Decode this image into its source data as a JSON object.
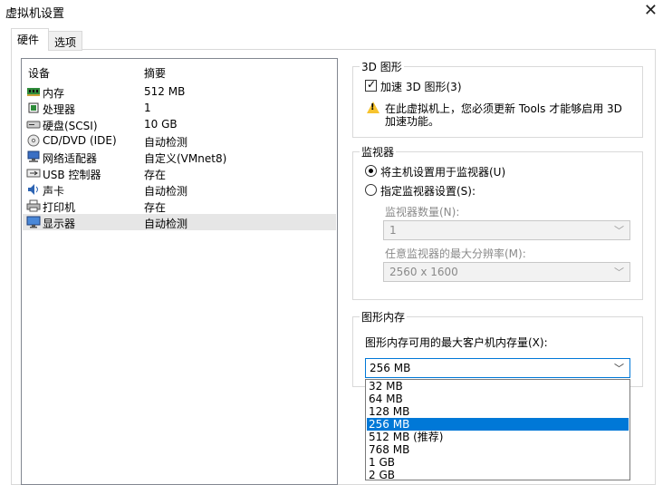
{
  "window": {
    "title": "虚拟机设置"
  },
  "tabs": [
    {
      "label": "硬件",
      "active": true
    },
    {
      "label": "选项",
      "active": false
    }
  ],
  "device_list": {
    "col_device": "设备",
    "col_summary": "摘要",
    "rows": [
      {
        "name": "内存",
        "summary": "512 MB",
        "icon": "memory-icon",
        "selected": false
      },
      {
        "name": "处理器",
        "summary": "1",
        "icon": "processor-icon",
        "selected": false
      },
      {
        "name": "硬盘(SCSI)",
        "summary": "10 GB",
        "icon": "harddisk-icon",
        "selected": false
      },
      {
        "name": "CD/DVD (IDE)",
        "summary": "自动检测",
        "icon": "cd-icon",
        "selected": false
      },
      {
        "name": "网络适配器",
        "summary": "自定义(VMnet8)",
        "icon": "network-icon",
        "selected": false
      },
      {
        "name": "USB 控制器",
        "summary": "存在",
        "icon": "usb-icon",
        "selected": false
      },
      {
        "name": "声卡",
        "summary": "自动检测",
        "icon": "sound-icon",
        "selected": false
      },
      {
        "name": "打印机",
        "summary": "存在",
        "icon": "printer-icon",
        "selected": false
      },
      {
        "name": "显示器",
        "summary": "自动检测",
        "icon": "monitor-icon",
        "selected": true
      }
    ]
  },
  "graphics3d": {
    "legend": "3D 图形",
    "accelerate_label": "加速 3D 图形(3)",
    "accelerate_checked": true,
    "warning_line1": "在此虚拟机上，您必须更新 Tools 才能够启用 3D",
    "warning_line2": "加速功能。"
  },
  "monitor": {
    "legend": "监视器",
    "radio_host": "将主机设置用于监视器(U)",
    "radio_specify": "指定监视器设置(S):",
    "selected": "host",
    "count_label": "监视器数量(N):",
    "count_value": "1",
    "maxres_label": "任意监视器的最大分辨率(M):",
    "maxres_value": "2560 x 1600"
  },
  "graphics_memory": {
    "legend": "图形内存",
    "label": "图形内存可用的最大客户机内存量(X):",
    "value": "256 MB",
    "options": [
      "32 MB",
      "64 MB",
      "128 MB",
      "256 MB",
      "512 MB (推荐)",
      "768 MB",
      "1 GB",
      "2 GB"
    ],
    "selected_index": 3
  }
}
